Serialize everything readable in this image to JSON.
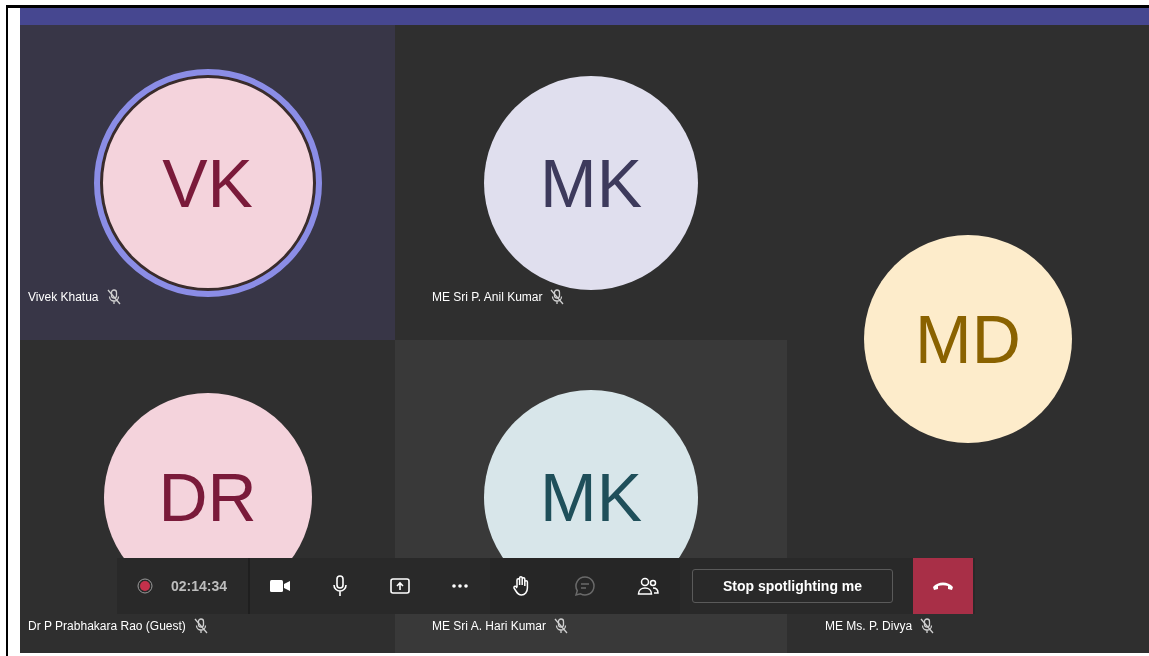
{
  "tiles": [
    {
      "initials": "VK",
      "name": "Vivek Khatua",
      "muted": true,
      "speaking": true,
      "color": "#f4d3dc"
    },
    {
      "initials": "MK",
      "name": "ME Sri P. Anil Kumar",
      "muted": true,
      "speaking": false,
      "color": "#e0dfee"
    },
    {
      "initials": "DR",
      "name": "Dr P Prabhakara Rao (Guest)",
      "muted": true,
      "speaking": false,
      "color": "#f4d3dc"
    },
    {
      "initials": "MK",
      "name": "ME Sri A. Hari Kumar",
      "muted": true,
      "speaking": false,
      "color": "#d8e6ea"
    },
    {
      "initials": "MD",
      "name": "ME Ms. P. Divya",
      "muted": true,
      "speaking": false,
      "color": "#fdeccb"
    }
  ],
  "toolbar": {
    "recording": true,
    "timer": "02:14:34",
    "buttons": [
      {
        "kind": "camera",
        "disabled": false
      },
      {
        "kind": "mic",
        "disabled": false
      },
      {
        "kind": "share",
        "disabled": false
      },
      {
        "kind": "more",
        "disabled": false
      },
      {
        "kind": "hand",
        "disabled": false
      },
      {
        "kind": "chat",
        "disabled": true
      },
      {
        "kind": "people",
        "disabled": false
      }
    ],
    "spotlight_button": "Stop spotlighting me"
  }
}
